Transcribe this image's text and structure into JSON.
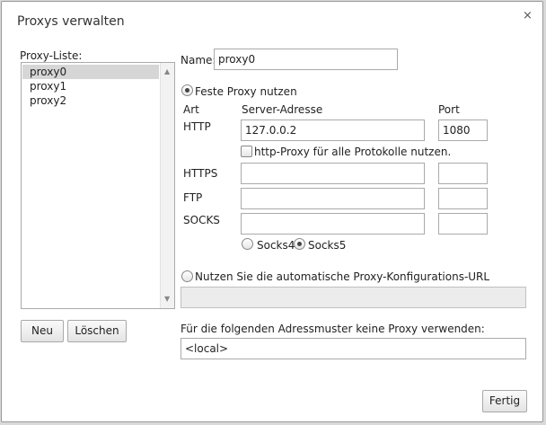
{
  "dialog": {
    "title": "Proxys verwalten",
    "close_glyph": "×"
  },
  "proxy_list": {
    "label": "Proxy-Liste:",
    "items": [
      "proxy0",
      "proxy1",
      "proxy2"
    ],
    "selected_index": 0,
    "scroll_up_glyph": "▲",
    "scroll_down_glyph": "▼"
  },
  "name": {
    "label": "Name:",
    "value": "proxy0"
  },
  "manual": {
    "radio_label": "Feste Proxy nutzen",
    "selected": true,
    "col_type": "Art",
    "col_server": "Server-Adresse",
    "col_port": "Port",
    "http": {
      "label": "HTTP",
      "server": "127.0.0.2",
      "port": "1080"
    },
    "all_protocols_checkbox": {
      "label": "http-Proxy für alle Protokolle nutzen.",
      "checked": false
    },
    "https": {
      "label": "HTTPS",
      "server": "",
      "port": ""
    },
    "ftp": {
      "label": "FTP",
      "server": "",
      "port": ""
    },
    "socks": {
      "label": "SOCKS",
      "server": "",
      "port": ""
    },
    "socks4_label": "Socks4",
    "socks5_label": "Socks5",
    "socks_version_selected": "Socks5"
  },
  "auto": {
    "radio_label": "Nutzen Sie die automatische Proxy-Konfigurations-URL",
    "selected": false,
    "url": ""
  },
  "bypass": {
    "label": "Für die folgenden Adressmuster keine Proxy verwenden:",
    "value": "<local>"
  },
  "buttons": {
    "new": "Neu",
    "delete": "Löschen",
    "done": "Fertig"
  }
}
